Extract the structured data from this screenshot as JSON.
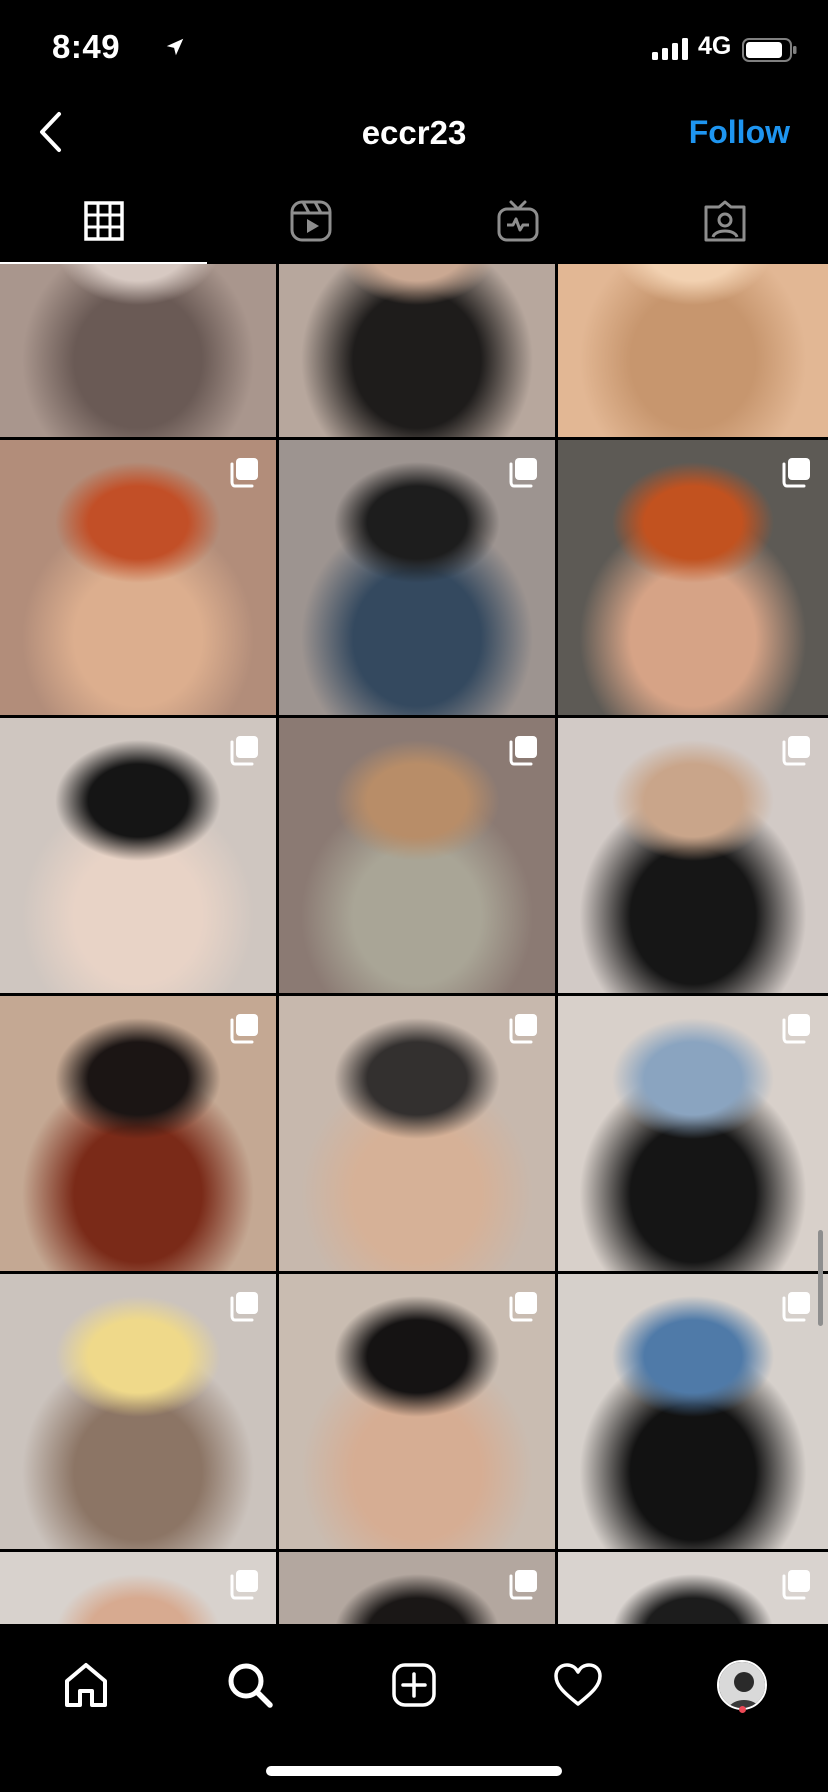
{
  "status_bar": {
    "time": "8:49",
    "network": "4G",
    "icons": [
      "location-arrow-icon",
      "signal-bars-icon",
      "battery-icon"
    ]
  },
  "header": {
    "back_icon": "chevron-left-icon",
    "username": "eccr23",
    "follow_label": "Follow"
  },
  "tabs": [
    {
      "name": "posts",
      "icon": "grid-icon",
      "active": true
    },
    {
      "name": "reels",
      "icon": "reels-icon",
      "active": false
    },
    {
      "name": "igtv",
      "icon": "igtv-icon",
      "active": false
    },
    {
      "name": "tagged",
      "icon": "tagged-user-icon",
      "active": false
    }
  ],
  "grid": {
    "columns": 3,
    "posts": [
      {
        "row": 0,
        "col": 0,
        "carousel": false,
        "tones": [
          "#a9968d",
          "#6a5a55",
          "#d7c9c2"
        ]
      },
      {
        "row": 0,
        "col": 1,
        "carousel": false,
        "tones": [
          "#b7a79d",
          "#1e1c1b",
          "#caa892"
        ]
      },
      {
        "row": 0,
        "col": 2,
        "carousel": false,
        "tones": [
          "#e2b794",
          "#c7966e",
          "#f2d1b1"
        ]
      },
      {
        "row": 1,
        "col": 0,
        "carousel": true,
        "tones": [
          "#b28d7a",
          "#dcae8e",
          "#c24f27"
        ]
      },
      {
        "row": 1,
        "col": 1,
        "carousel": true,
        "tones": [
          "#9d9490",
          "#34495f",
          "#1d1d1d"
        ]
      },
      {
        "row": 1,
        "col": 2,
        "carousel": true,
        "tones": [
          "#5d5a55",
          "#d6a386",
          "#c2521f"
        ]
      },
      {
        "row": 2,
        "col": 0,
        "carousel": true,
        "tones": [
          "#cfc6c0",
          "#e8d3c6",
          "#151515"
        ]
      },
      {
        "row": 2,
        "col": 1,
        "carousel": true,
        "tones": [
          "#8b7a73",
          "#a9a596",
          "#b88d68"
        ]
      },
      {
        "row": 2,
        "col": 2,
        "carousel": true,
        "tones": [
          "#d2cac6",
          "#161616",
          "#c9a58a"
        ]
      },
      {
        "row": 3,
        "col": 0,
        "carousel": true,
        "tones": [
          "#c4a893",
          "#7a2a18",
          "#1b1514"
        ]
      },
      {
        "row": 3,
        "col": 1,
        "carousel": true,
        "tones": [
          "#c7b8ad",
          "#d6b197",
          "#33302f"
        ]
      },
      {
        "row": 3,
        "col": 2,
        "carousel": true,
        "tones": [
          "#d8d0ca",
          "#151515",
          "#8aa4c0"
        ]
      },
      {
        "row": 4,
        "col": 0,
        "carousel": true,
        "tones": [
          "#cbc3bd",
          "#8c7565",
          "#efd98a"
        ]
      },
      {
        "row": 4,
        "col": 1,
        "carousel": true,
        "tones": [
          "#c9bcb1",
          "#d6ad93",
          "#151313"
        ]
      },
      {
        "row": 4,
        "col": 2,
        "carousel": true,
        "tones": [
          "#d6d0cb",
          "#121212",
          "#4f7aa8"
        ]
      },
      {
        "row": 5,
        "col": 0,
        "carousel": true,
        "tones": [
          "#d8d2cd",
          "#4a3b35",
          "#d7aa90"
        ]
      },
      {
        "row": 5,
        "col": 1,
        "carousel": true,
        "tones": [
          "#b3a79f",
          "#9b958f",
          "#1a1716"
        ]
      },
      {
        "row": 5,
        "col": 2,
        "carousel": true,
        "tones": [
          "#d9d3cf",
          "#b2a7a5",
          "#1c1c1c"
        ]
      }
    ]
  },
  "bottom_nav": [
    {
      "name": "home",
      "icon": "home-icon"
    },
    {
      "name": "search",
      "icon": "search-icon"
    },
    {
      "name": "new-post",
      "icon": "plus-square-icon"
    },
    {
      "name": "activity",
      "icon": "heart-icon"
    },
    {
      "name": "profile",
      "icon": "profile-avatar-icon",
      "notification_dot": true
    }
  ],
  "colors": {
    "background": "#000000",
    "accent": "#1e95f0",
    "text": "#ffffff",
    "notification": "#ed4956"
  }
}
